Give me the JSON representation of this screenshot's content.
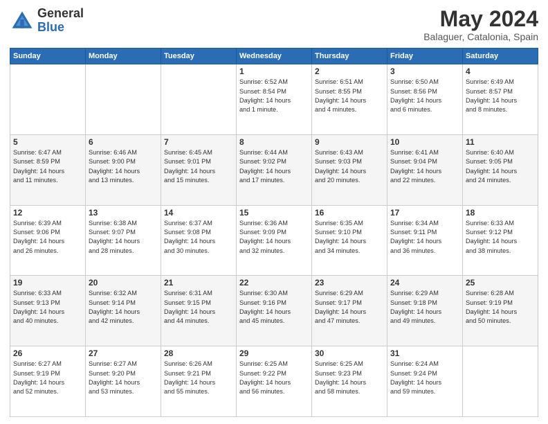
{
  "header": {
    "logo": {
      "general": "General",
      "blue": "Blue"
    },
    "month_year": "May 2024",
    "location": "Balaguer, Catalonia, Spain"
  },
  "days_of_week": [
    "Sunday",
    "Monday",
    "Tuesday",
    "Wednesday",
    "Thursday",
    "Friday",
    "Saturday"
  ],
  "weeks": [
    [
      {
        "day": "",
        "info": ""
      },
      {
        "day": "",
        "info": ""
      },
      {
        "day": "",
        "info": ""
      },
      {
        "day": "1",
        "info": "Sunrise: 6:52 AM\nSunset: 8:54 PM\nDaylight: 14 hours\nand 1 minute."
      },
      {
        "day": "2",
        "info": "Sunrise: 6:51 AM\nSunset: 8:55 PM\nDaylight: 14 hours\nand 4 minutes."
      },
      {
        "day": "3",
        "info": "Sunrise: 6:50 AM\nSunset: 8:56 PM\nDaylight: 14 hours\nand 6 minutes."
      },
      {
        "day": "4",
        "info": "Sunrise: 6:49 AM\nSunset: 8:57 PM\nDaylight: 14 hours\nand 8 minutes."
      }
    ],
    [
      {
        "day": "5",
        "info": "Sunrise: 6:47 AM\nSunset: 8:59 PM\nDaylight: 14 hours\nand 11 minutes."
      },
      {
        "day": "6",
        "info": "Sunrise: 6:46 AM\nSunset: 9:00 PM\nDaylight: 14 hours\nand 13 minutes."
      },
      {
        "day": "7",
        "info": "Sunrise: 6:45 AM\nSunset: 9:01 PM\nDaylight: 14 hours\nand 15 minutes."
      },
      {
        "day": "8",
        "info": "Sunrise: 6:44 AM\nSunset: 9:02 PM\nDaylight: 14 hours\nand 17 minutes."
      },
      {
        "day": "9",
        "info": "Sunrise: 6:43 AM\nSunset: 9:03 PM\nDaylight: 14 hours\nand 20 minutes."
      },
      {
        "day": "10",
        "info": "Sunrise: 6:41 AM\nSunset: 9:04 PM\nDaylight: 14 hours\nand 22 minutes."
      },
      {
        "day": "11",
        "info": "Sunrise: 6:40 AM\nSunset: 9:05 PM\nDaylight: 14 hours\nand 24 minutes."
      }
    ],
    [
      {
        "day": "12",
        "info": "Sunrise: 6:39 AM\nSunset: 9:06 PM\nDaylight: 14 hours\nand 26 minutes."
      },
      {
        "day": "13",
        "info": "Sunrise: 6:38 AM\nSunset: 9:07 PM\nDaylight: 14 hours\nand 28 minutes."
      },
      {
        "day": "14",
        "info": "Sunrise: 6:37 AM\nSunset: 9:08 PM\nDaylight: 14 hours\nand 30 minutes."
      },
      {
        "day": "15",
        "info": "Sunrise: 6:36 AM\nSunset: 9:09 PM\nDaylight: 14 hours\nand 32 minutes."
      },
      {
        "day": "16",
        "info": "Sunrise: 6:35 AM\nSunset: 9:10 PM\nDaylight: 14 hours\nand 34 minutes."
      },
      {
        "day": "17",
        "info": "Sunrise: 6:34 AM\nSunset: 9:11 PM\nDaylight: 14 hours\nand 36 minutes."
      },
      {
        "day": "18",
        "info": "Sunrise: 6:33 AM\nSunset: 9:12 PM\nDaylight: 14 hours\nand 38 minutes."
      }
    ],
    [
      {
        "day": "19",
        "info": "Sunrise: 6:33 AM\nSunset: 9:13 PM\nDaylight: 14 hours\nand 40 minutes."
      },
      {
        "day": "20",
        "info": "Sunrise: 6:32 AM\nSunset: 9:14 PM\nDaylight: 14 hours\nand 42 minutes."
      },
      {
        "day": "21",
        "info": "Sunrise: 6:31 AM\nSunset: 9:15 PM\nDaylight: 14 hours\nand 44 minutes."
      },
      {
        "day": "22",
        "info": "Sunrise: 6:30 AM\nSunset: 9:16 PM\nDaylight: 14 hours\nand 45 minutes."
      },
      {
        "day": "23",
        "info": "Sunrise: 6:29 AM\nSunset: 9:17 PM\nDaylight: 14 hours\nand 47 minutes."
      },
      {
        "day": "24",
        "info": "Sunrise: 6:29 AM\nSunset: 9:18 PM\nDaylight: 14 hours\nand 49 minutes."
      },
      {
        "day": "25",
        "info": "Sunrise: 6:28 AM\nSunset: 9:19 PM\nDaylight: 14 hours\nand 50 minutes."
      }
    ],
    [
      {
        "day": "26",
        "info": "Sunrise: 6:27 AM\nSunset: 9:19 PM\nDaylight: 14 hours\nand 52 minutes."
      },
      {
        "day": "27",
        "info": "Sunrise: 6:27 AM\nSunset: 9:20 PM\nDaylight: 14 hours\nand 53 minutes."
      },
      {
        "day": "28",
        "info": "Sunrise: 6:26 AM\nSunset: 9:21 PM\nDaylight: 14 hours\nand 55 minutes."
      },
      {
        "day": "29",
        "info": "Sunrise: 6:25 AM\nSunset: 9:22 PM\nDaylight: 14 hours\nand 56 minutes."
      },
      {
        "day": "30",
        "info": "Sunrise: 6:25 AM\nSunset: 9:23 PM\nDaylight: 14 hours\nand 58 minutes."
      },
      {
        "day": "31",
        "info": "Sunrise: 6:24 AM\nSunset: 9:24 PM\nDaylight: 14 hours\nand 59 minutes."
      },
      {
        "day": "",
        "info": ""
      }
    ]
  ]
}
